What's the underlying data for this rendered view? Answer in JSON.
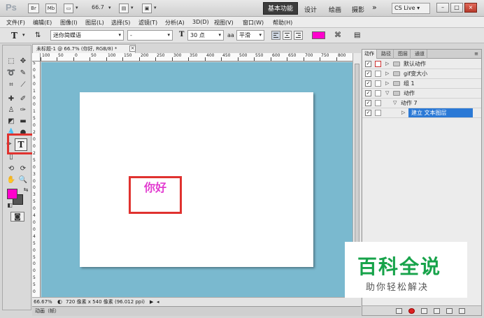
{
  "app": {
    "logo": "Ps",
    "br_label": "Br",
    "mb_label": "Mb",
    "zoom": "66.7",
    "workspaces": [
      "基本功能",
      "设计",
      "绘画",
      "摄影"
    ],
    "more": "»",
    "cs_live": "CS Live",
    "window_controls": [
      "minimize-icon",
      "restore-icon",
      "close-icon"
    ]
  },
  "menu": [
    "文件(F)",
    "编辑(E)",
    "图像(I)",
    "图层(L)",
    "选择(S)",
    "滤镜(T)",
    "分析(A)",
    "3D(D)",
    "视图(V)",
    "窗口(W)",
    "帮助(H)"
  ],
  "options": {
    "tool_glyph": "T",
    "font_family": "迷你简蝶语",
    "font_style": "-",
    "font_size_icon": "T",
    "font_size": "30 点",
    "aa_icon": "aa",
    "antialias": "平滑",
    "text_color": "#ff00cc"
  },
  "document": {
    "tab_title": "未标题-1 @ 66.7% (你好, RGB/8) *",
    "close": "×",
    "ruler_top": [
      "100",
      "50",
      "0",
      "50",
      "100",
      "150",
      "200",
      "250",
      "300",
      "350",
      "400",
      "450",
      "500",
      "550",
      "600",
      "650",
      "700",
      "750",
      "800"
    ],
    "ruler_left": [
      "5",
      "0",
      "5",
      "0",
      "1",
      "0",
      "0",
      "1",
      "5",
      "0",
      "2",
      "0",
      "0",
      "2",
      "5",
      "0",
      "3",
      "0",
      "0",
      "3",
      "5",
      "0",
      "4",
      "0",
      "0",
      "4",
      "5",
      "0",
      "5",
      "0",
      "0",
      "5",
      "5",
      "0"
    ],
    "text_layer": "你好",
    "canvas_bg": "#7ab9cf",
    "zoom_status": "66.67%",
    "doc_info": "720 像素 x 540 像素 (96.012 ppi)",
    "animation_tab": "动画（帧）"
  },
  "actions_panel": {
    "tabs": [
      "动作",
      "路径",
      "图层",
      "通道"
    ],
    "rows": [
      {
        "label": "默认动作",
        "checked": true,
        "dialog": true,
        "expanded": false,
        "type": "set"
      },
      {
        "label": "gif变大小",
        "checked": true,
        "dialog": false,
        "expanded": false,
        "type": "set"
      },
      {
        "label": "组 1",
        "checked": true,
        "dialog": false,
        "expanded": false,
        "type": "set"
      },
      {
        "label": "动作",
        "checked": true,
        "dialog": false,
        "expanded": true,
        "type": "set"
      },
      {
        "label": "动作 7",
        "checked": true,
        "dialog": false,
        "expanded": true,
        "type": "action"
      },
      {
        "label": "建立 文本图层",
        "checked": true,
        "dialog": false,
        "expanded": false,
        "type": "step",
        "selected": true
      }
    ]
  },
  "watermark": {
    "brand": "百科全说",
    "tagline": "助你轻松解决"
  }
}
